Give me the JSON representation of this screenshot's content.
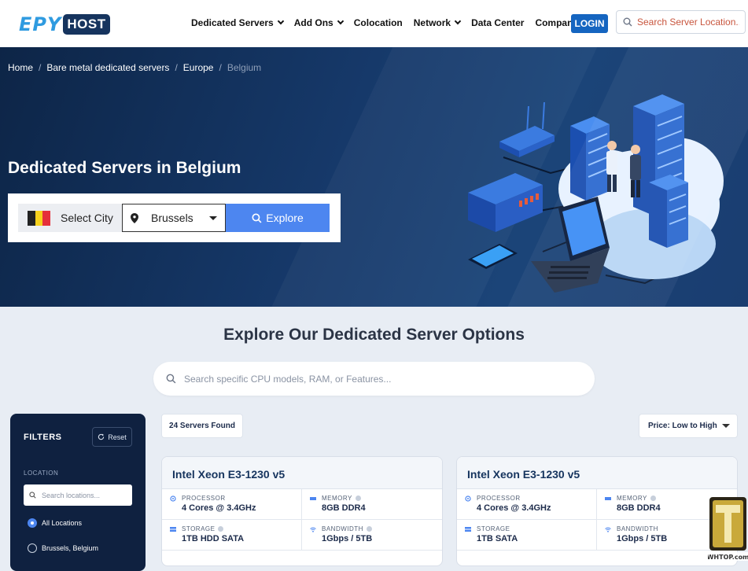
{
  "header": {
    "logo_part1": "EPY",
    "logo_part2": "HOST",
    "nav": [
      {
        "label": "Dedicated Servers",
        "has_dropdown": true
      },
      {
        "label": "Add Ons",
        "has_dropdown": true
      },
      {
        "label": "Colocation",
        "has_dropdown": false
      },
      {
        "label": "Network",
        "has_dropdown": true
      },
      {
        "label": "Data Center",
        "has_dropdown": false
      },
      {
        "label": "Company",
        "has_dropdown": true
      }
    ],
    "login_label": "LOGIN",
    "search_placeholder": "Search Server Location..."
  },
  "breadcrumb": {
    "items": [
      "Home",
      "Bare metal dedicated servers",
      "Europe"
    ],
    "current": "Belgium"
  },
  "hero": {
    "title": "Dedicated Servers in Belgium",
    "select_city_label": "Select City",
    "city_value": "Brussels",
    "explore_label": "Explore",
    "flag_colors": [
      "#222222",
      "#f6d11c",
      "#e5303a"
    ]
  },
  "section": {
    "title": "Explore Our Dedicated Server Options",
    "search_placeholder": "Search specific CPU models, RAM, or Features..."
  },
  "filters": {
    "title": "FILTERS",
    "reset_label": "Reset",
    "location_label": "LOCATION",
    "location_placeholder": "Search locations...",
    "options": [
      {
        "label": "All Locations",
        "selected": true
      },
      {
        "label": "Brussels, Belgium",
        "selected": false
      }
    ]
  },
  "results": {
    "count_label": "24 Servers Found",
    "sort_label": "Price: Low to High"
  },
  "cards": [
    {
      "title": "Intel Xeon E3-1230 v5",
      "specs": [
        {
          "label": "PROCESSOR",
          "value": "4 Cores @ 3.4GHz",
          "info": false,
          "icon": "cpu-icon"
        },
        {
          "label": "MEMORY",
          "value": "8GB DDR4",
          "info": true,
          "icon": "memory-icon"
        },
        {
          "label": "STORAGE",
          "value": "1TB HDD SATA",
          "info": true,
          "icon": "storage-icon"
        },
        {
          "label": "BANDWIDTH",
          "value": "1Gbps / 5TB",
          "info": true,
          "icon": "wifi-icon"
        }
      ]
    },
    {
      "title": "Intel Xeon E3-1230 v5",
      "specs": [
        {
          "label": "PROCESSOR",
          "value": "4 Cores @ 3.4GHz",
          "info": false,
          "icon": "cpu-icon"
        },
        {
          "label": "MEMORY",
          "value": "8GB DDR4",
          "info": true,
          "icon": "memory-icon"
        },
        {
          "label": "STORAGE",
          "value": "1TB SATA",
          "info": false,
          "icon": "storage-icon"
        },
        {
          "label": "BANDWIDTH",
          "value": "1Gbps / 5TB",
          "info": false,
          "icon": "wifi-icon"
        }
      ]
    }
  ],
  "watermark": {
    "text": "WHTOP.com"
  },
  "colors": {
    "accent": "#4d86f0",
    "brand_dark": "#16345e",
    "login": "#1565c0"
  }
}
